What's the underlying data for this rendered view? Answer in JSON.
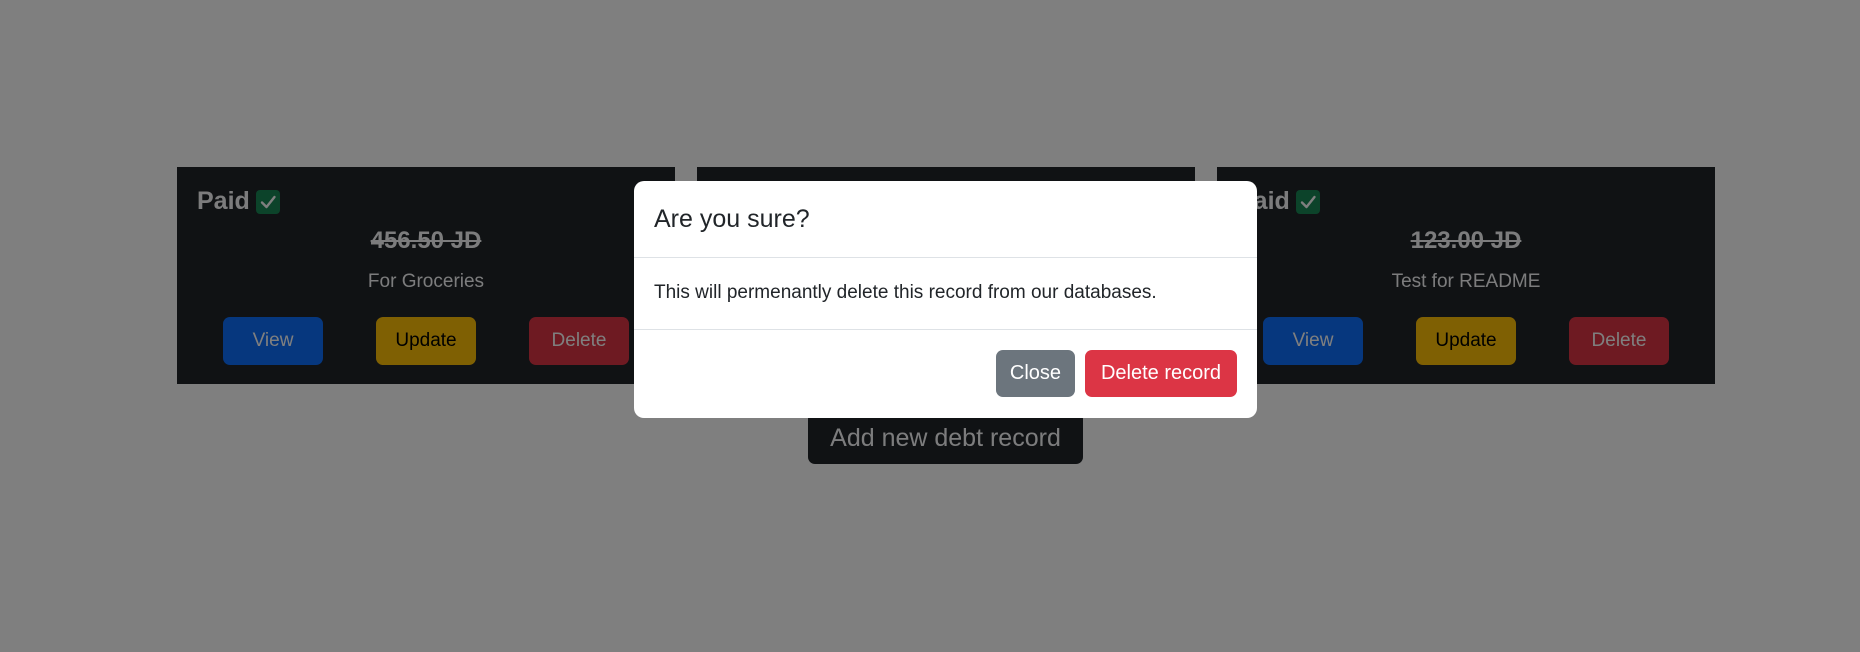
{
  "cards": [
    {
      "status": "Paid",
      "amount": "456.50 JD",
      "description": "For Groceries",
      "view_label": "View",
      "update_label": "Update",
      "delete_label": "Delete"
    },
    {
      "status": "",
      "amount": "",
      "description": "",
      "view_label": "",
      "update_label": "",
      "delete_label": ""
    },
    {
      "status": "Paid",
      "amount": "123.00 JD",
      "description": "Test for README",
      "view_label": "View",
      "update_label": "Update",
      "delete_label": "Delete"
    }
  ],
  "add_button_label": "Add new debt record",
  "modal": {
    "title": "Are you sure?",
    "body": "This will permenantly delete this record from our databases.",
    "close_label": "Close",
    "delete_label": "Delete record"
  },
  "colors": {
    "paid_check": "#198754",
    "view": "#0d6efd",
    "update": "#ffc107",
    "delete": "#dc3545",
    "close": "#6c757d",
    "card_bg": "#212529"
  },
  "icons": {
    "paid_status": "check-square-icon"
  }
}
